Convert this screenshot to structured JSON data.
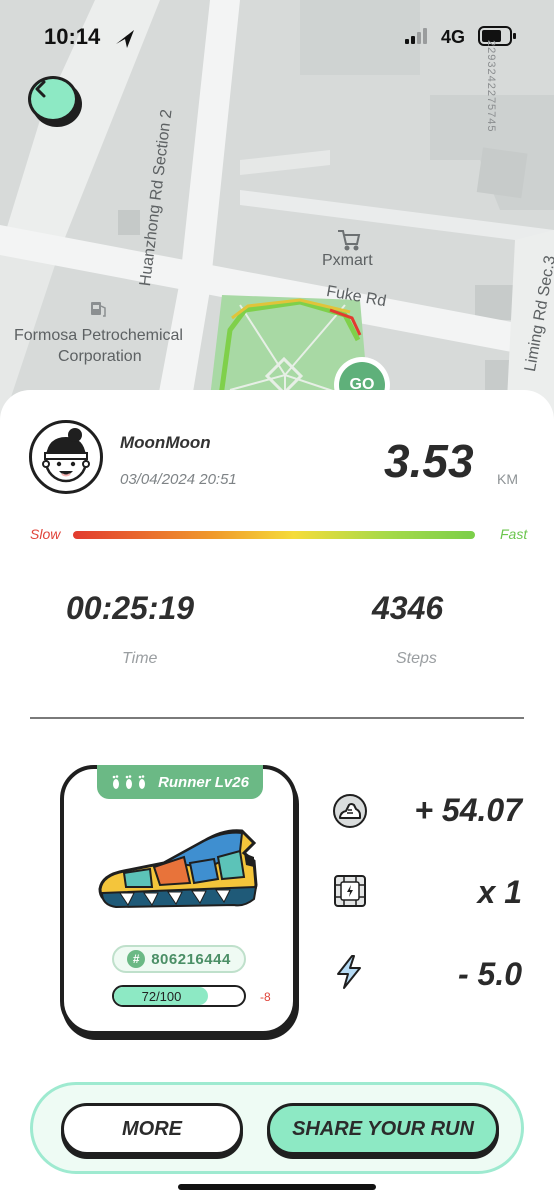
{
  "status_bar": {
    "time": "10:14",
    "network": "4G"
  },
  "map": {
    "labels": {
      "road_huanzhong": "Huanzhong Rd Section 2",
      "road_fuke": "Fuke Rd",
      "road_liming": "Liming Rd Sec.3",
      "poi_pxmart": "Pxmart",
      "poi_formosa_line1": "Formosa Petrochemical",
      "poi_formosa_line2": "Corporation"
    },
    "code": "2293242275745",
    "go_label": "GO",
    "route_color": "#7fd04a",
    "park_color": "#a8d9a4"
  },
  "run": {
    "username": "MoonMoon",
    "date": "03/04/2024 20:51",
    "distance": "3.53",
    "distance_unit": "KM",
    "speed": {
      "slow_label": "Slow",
      "fast_label": "Fast"
    },
    "time_value": "00:25:19",
    "time_label": "Time",
    "steps_value": "4346",
    "steps_label": "Steps"
  },
  "sneaker": {
    "tag_label": "Runner Lv26",
    "id_number": "806216444",
    "durability_text": "72/100",
    "durability_fraction": 0.72,
    "durability_change": "-8"
  },
  "rewards": {
    "shoe_points": "+ 54.07",
    "mystery_box": "x 1",
    "energy": "- 5.0"
  },
  "actions": {
    "more_label": "MORE",
    "share_label": "SHARE YOUR RUN"
  },
  "colors": {
    "accent_mint": "#8de9c4",
    "brand_green": "#6bb985",
    "slow_red": "#e0443a",
    "fast_green": "#6bc64d"
  }
}
